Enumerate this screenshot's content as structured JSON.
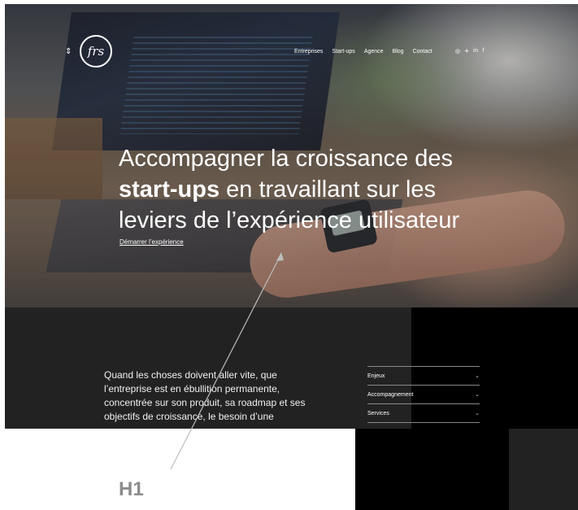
{
  "header": {
    "menu_toggle_glyph": "⇕",
    "logo_text": "frs",
    "nav": [
      "Entreprises",
      "Start-ups",
      "Agence",
      "Blog",
      "Contact"
    ],
    "social": [
      "◎",
      "✦",
      "in",
      "f"
    ]
  },
  "hero": {
    "line1": "Accompagner la croissance des",
    "line2_bold": "start-ups",
    "line2_rest": " en travaillant sur les",
    "line3": "leviers de l’expérience utilisateur",
    "cta": "Démarrer l’expérience"
  },
  "section": {
    "intro": "Quand les choses doivent aller vite, que l’entreprise est en ébullition permanente, concentrée sur son produit, sa roadmap et ses objectifs de croissance, le besoin d’une",
    "menu": [
      {
        "label": "Enjeux",
        "chevron": "⌄"
      },
      {
        "label": "Accompagnement",
        "chevron": "⌄"
      },
      {
        "label": "Services",
        "chevron": "⌄"
      }
    ]
  },
  "annotation": {
    "label": "H1"
  },
  "colors": {
    "dark_section": "#222222",
    "annotation_gray": "#8c8c8c"
  }
}
